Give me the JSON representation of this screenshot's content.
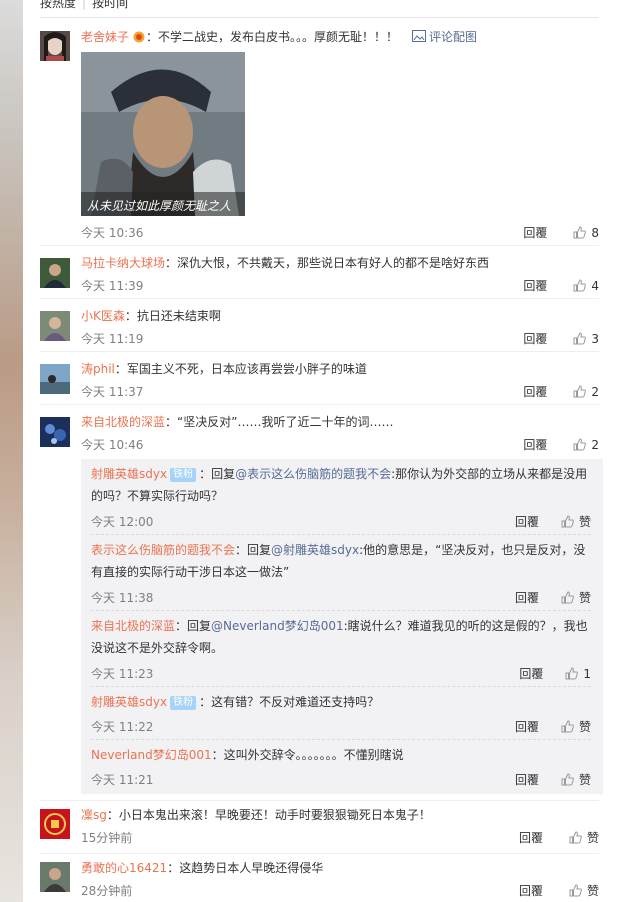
{
  "sort": {
    "hot": "按热度",
    "time": "按时间"
  },
  "reply_label": "回覆",
  "like_label": "赞",
  "comments": [
    {
      "user": "老舍妹子",
      "text": "：不学二战史，发布白皮书。。。厚颜无耻！！！",
      "extra": "评论配图",
      "image_caption": "从未见过如此厚颜无耻之人",
      "time": "今天 10:36",
      "likes": "8"
    },
    {
      "user": "马拉卡纳大球场",
      "text": "：深仇大恨，不共戴天，那些说日本有好人的都不是啥好东西",
      "time": "今天 11:39",
      "likes": "4"
    },
    {
      "user": "小K医森",
      "text": "：抗日还未结束啊",
      "time": "今天 11:19",
      "likes": "3"
    },
    {
      "user": "涛phil",
      "text": "：军国主义不死，日本应该再尝尝小胖子的味道",
      "time": "今天 11:37",
      "likes": "2"
    },
    {
      "user": "来自北极的深蓝",
      "text": "：“坚决反对”……我听了近二十年的词……",
      "time": "今天 10:46",
      "likes": "2"
    },
    {
      "user": "凜sg",
      "text": "：小日本鬼出来滚！早晚要还！动手时要狠狠锄死日本鬼子！",
      "time": "15分钟前",
      "likes": ""
    },
    {
      "user": "勇敢的心16421",
      "text": "：这趋势日本人早晚还得侵华",
      "time": "28分钟前",
      "likes": ""
    }
  ],
  "replies": [
    {
      "user": "射雕英雄sdyx",
      "badge": "铁粉",
      "prefix": "：回复",
      "mention": "@表示这么伤脑筋的题我不会",
      "line1": ":那你认为外交部的立场从来都是没用",
      "line2": "的吗？不算实际行动吗？",
      "time": "今天 12:00",
      "likes": ""
    },
    {
      "user": "表示这么伤脑筋的题我不会",
      "prefix": "：回复",
      "mention": "@射雕英雄sdyx",
      "line1": ":他的意思是，“坚决反对，也只是反对，没",
      "line2": "有直接的实际行动干涉日本这一做法”",
      "time": "今天 11:38",
      "likes": ""
    },
    {
      "user": "来自北极的深蓝",
      "prefix": "：回复",
      "mention": "@Neverland梦幻岛001",
      "line1": ":瞎说什么？难道我见的听的这是假的？，我也",
      "line2": "没说这不是外交辞令啊。",
      "time": "今天 11:23",
      "likes": "1"
    },
    {
      "user": "射雕英雄sdyx",
      "badge": "铁粉",
      "line1": "：这有错？不反对难道还支持吗？",
      "time": "今天 11:22",
      "likes": ""
    },
    {
      "user": "Neverland梦幻岛001",
      "line1": "：这叫外交辞令。。。。。。。不懂别瞎说",
      "time": "今天 11:21",
      "likes": ""
    }
  ]
}
